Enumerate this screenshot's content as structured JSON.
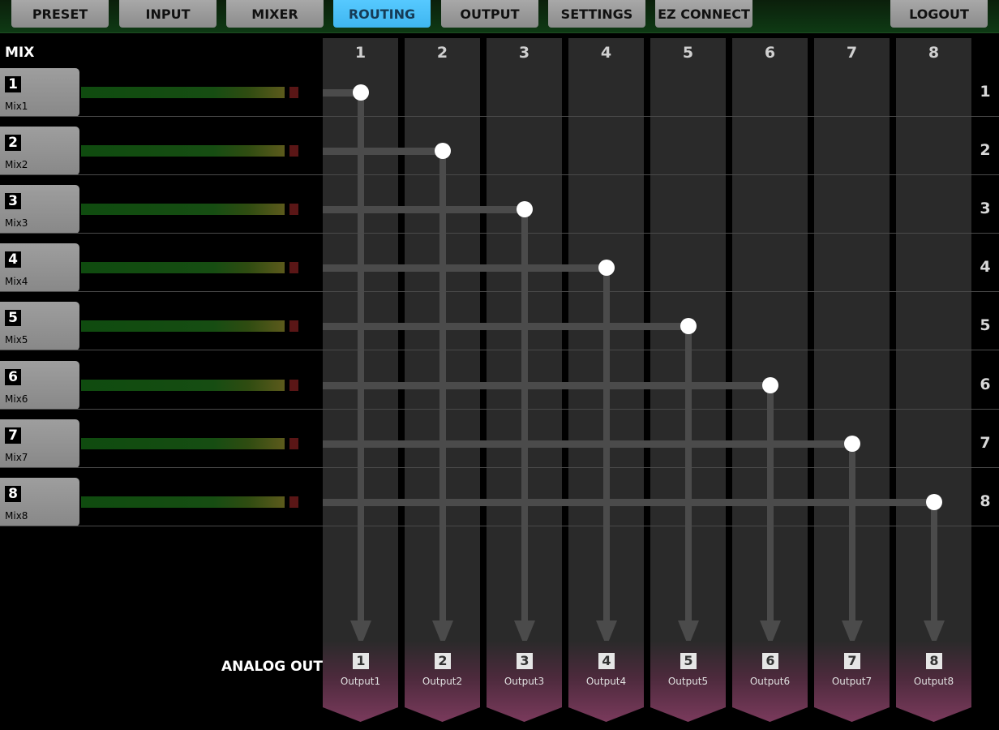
{
  "nav": {
    "preset": "PRESET",
    "input": "INPUT",
    "mixer": "MIXER",
    "routing": "ROUTING",
    "output": "OUTPUT",
    "settings": "SETTINGS",
    "ez_connect": "EZ CONNECT",
    "logout": "LOGOUT",
    "active_tab": "ROUTING"
  },
  "mix_section": {
    "title": "MIX"
  },
  "mixes": [
    {
      "number": "1",
      "name": "Mix1"
    },
    {
      "number": "2",
      "name": "Mix2"
    },
    {
      "number": "3",
      "name": "Mix3"
    },
    {
      "number": "4",
      "name": "Mix4"
    },
    {
      "number": "5",
      "name": "Mix5"
    },
    {
      "number": "6",
      "name": "Mix6"
    },
    {
      "number": "7",
      "name": "Mix7"
    },
    {
      "number": "8",
      "name": "Mix8"
    }
  ],
  "columns": [
    "1",
    "2",
    "3",
    "4",
    "5",
    "6",
    "7",
    "8"
  ],
  "row_labels": [
    "1",
    "2",
    "3",
    "4",
    "5",
    "6",
    "7",
    "8"
  ],
  "routing": [
    {
      "mix": "1",
      "output": "1"
    },
    {
      "mix": "2",
      "output": "2"
    },
    {
      "mix": "3",
      "output": "3"
    },
    {
      "mix": "4",
      "output": "4"
    },
    {
      "mix": "5",
      "output": "5"
    },
    {
      "mix": "6",
      "output": "6"
    },
    {
      "mix": "7",
      "output": "7"
    },
    {
      "mix": "8",
      "output": "8"
    }
  ],
  "analog_out": {
    "title": "ANALOG OUT",
    "outputs": [
      {
        "number": "1",
        "name": "Output1"
      },
      {
        "number": "2",
        "name": "Output2"
      },
      {
        "number": "3",
        "name": "Output3"
      },
      {
        "number": "4",
        "name": "Output4"
      },
      {
        "number": "5",
        "name": "Output5"
      },
      {
        "number": "6",
        "name": "Output6"
      },
      {
        "number": "7",
        "name": "Output7"
      },
      {
        "number": "8",
        "name": "Output8"
      }
    ]
  },
  "colors": {
    "accent_active_tab": "#56c9ff",
    "meter_green": "#164d12",
    "clip_red": "#5a1616",
    "output_tab": "#7a3a5c"
  }
}
